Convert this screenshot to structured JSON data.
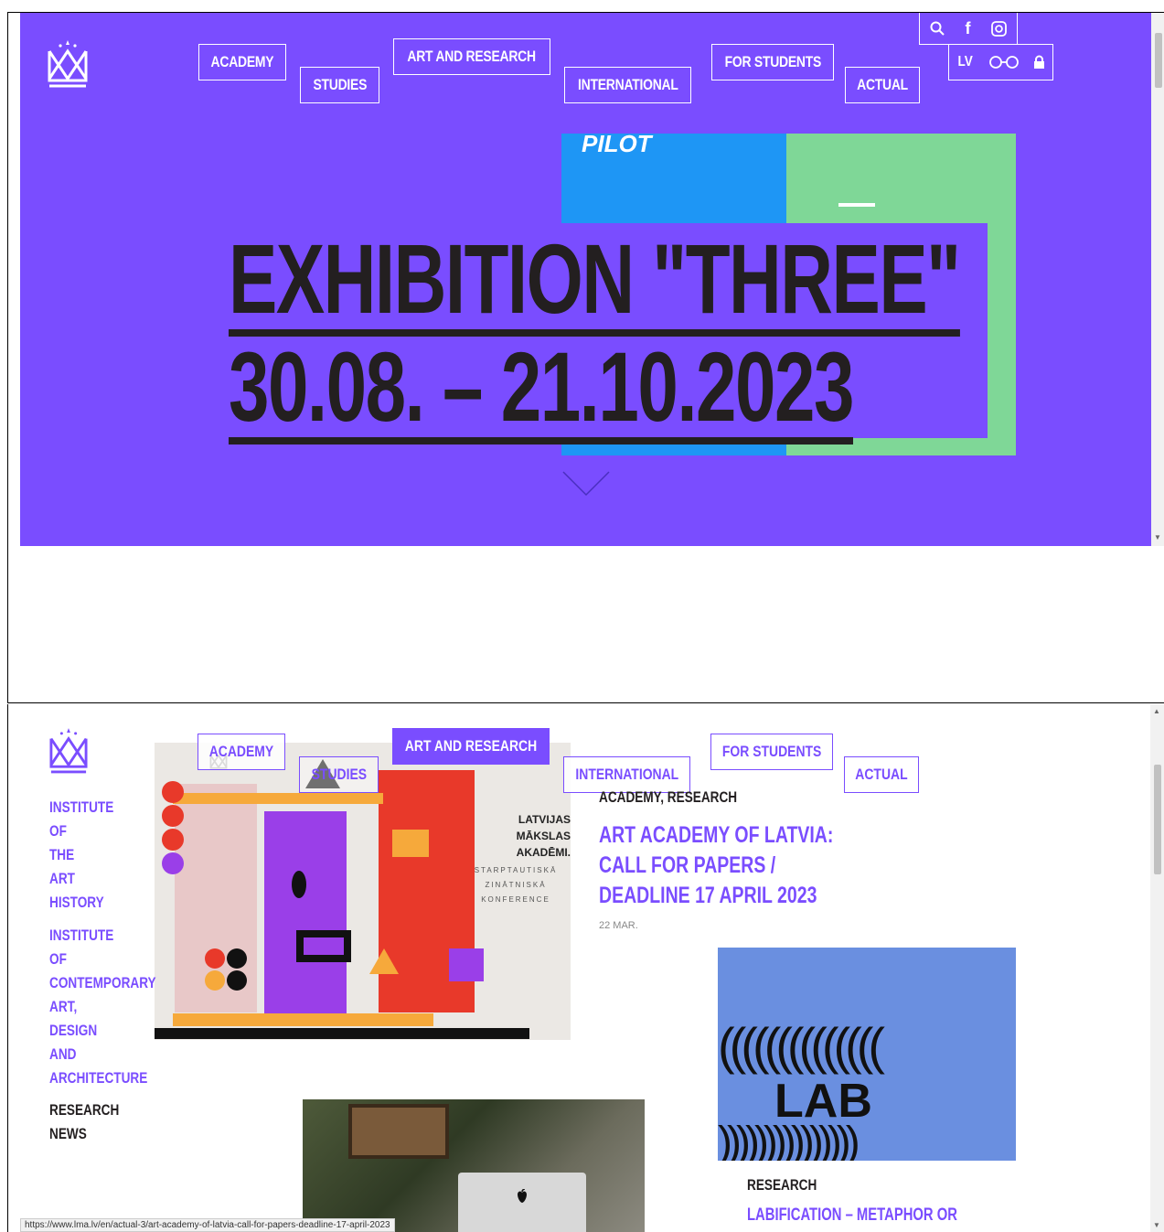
{
  "nav": {
    "academy": "ACADEMY",
    "studies": "STUDIES",
    "art_research": "ART AND RESEARCH",
    "international": "INTERNATIONAL",
    "for_students": "FOR STUDENTS",
    "actual": "ACTUAL"
  },
  "utility": {
    "search_icon": "search-icon",
    "facebook_icon": "f",
    "instagram_icon": "instagram-icon",
    "language": "LV",
    "accessibility_icon": "glasses-icon",
    "lock_icon": "lock-icon"
  },
  "hero": {
    "poster_text": "PILOT",
    "title_line1": "EXHIBITION \"THREE\"",
    "title_line2": "30.08. – 21.10.2023",
    "scroll_icon": "chevron-down-icon"
  },
  "sidebar": {
    "link1_lines": [
      "INSTITUTE",
      "OF",
      "THE",
      "ART",
      "HISTORY"
    ],
    "link2_lines": [
      "INSTITUTE",
      "OF",
      "CONTEMPORARY",
      "ART,",
      "DESIGN",
      "AND",
      "ARCHITECTURE"
    ],
    "plain_lines": [
      "RESEARCH",
      "NEWS"
    ]
  },
  "articles": [
    {
      "category": "ACADEMY, RESEARCH",
      "title_lines": [
        "ART ACADEMY OF LATVIA:",
        "CALL FOR PAPERS /",
        "DEADLINE 17 APRIL 2023"
      ],
      "date": "22 MAR."
    },
    {
      "category": "RESEARCH",
      "title_lines": [
        "LABIFICATION – METAPHOR OR"
      ]
    }
  ],
  "poster": {
    "lines": [
      "LATVIJAS",
      "MĀKSLAS",
      "AKADĒMI."
    ],
    "sub_lines": [
      "STARPTAUTISKĀ",
      "ZINĀTNISKĀ",
      "KONFERENCE"
    ]
  },
  "lab_image_text": "LAB",
  "status_url": "https://www.lma.lv/en/actual-3/art-academy-of-latvia-call-for-papers-deadline-17-april-2023",
  "colors": {
    "brand_purple": "#7a4dff",
    "blue": "#1e96f5",
    "green": "#7fd797",
    "dark": "#231f20"
  }
}
